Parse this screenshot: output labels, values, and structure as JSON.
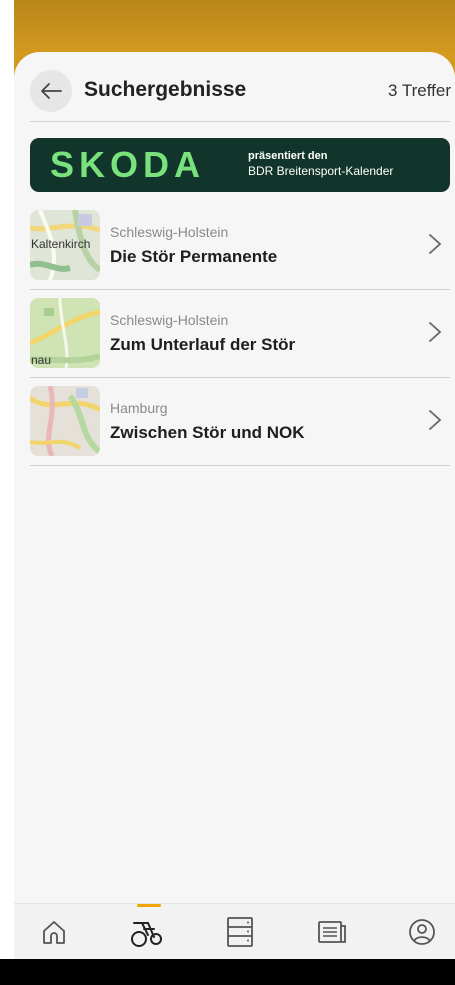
{
  "header": {
    "title": "Suchergebnisse",
    "hits": "3 Treffer"
  },
  "banner": {
    "brand": "SKODA",
    "line1": "präsentiert den",
    "line2": "BDR Breitensport-Kalender",
    "bg_color": "#11352b",
    "brand_color": "#7ae27d"
  },
  "results": [
    {
      "region": "Schleswig-Holstein",
      "name": "Die Stör Permanente",
      "map_label": "Kaltenkirch"
    },
    {
      "region": "Schleswig-Holstein",
      "name": "Zum Unterlauf der Stör",
      "map_label": "nau"
    },
    {
      "region": "Hamburg",
      "name": "Zwischen Stör und NOK",
      "map_label": ""
    }
  ],
  "tabbar": {
    "items": [
      {
        "icon": "home-icon",
        "active": false
      },
      {
        "icon": "cyclist-icon",
        "active": true
      },
      {
        "icon": "server-list-icon",
        "active": false
      },
      {
        "icon": "news-icon",
        "active": false
      },
      {
        "icon": "profile-icon",
        "active": false
      }
    ],
    "active_color": "#f0a500"
  }
}
